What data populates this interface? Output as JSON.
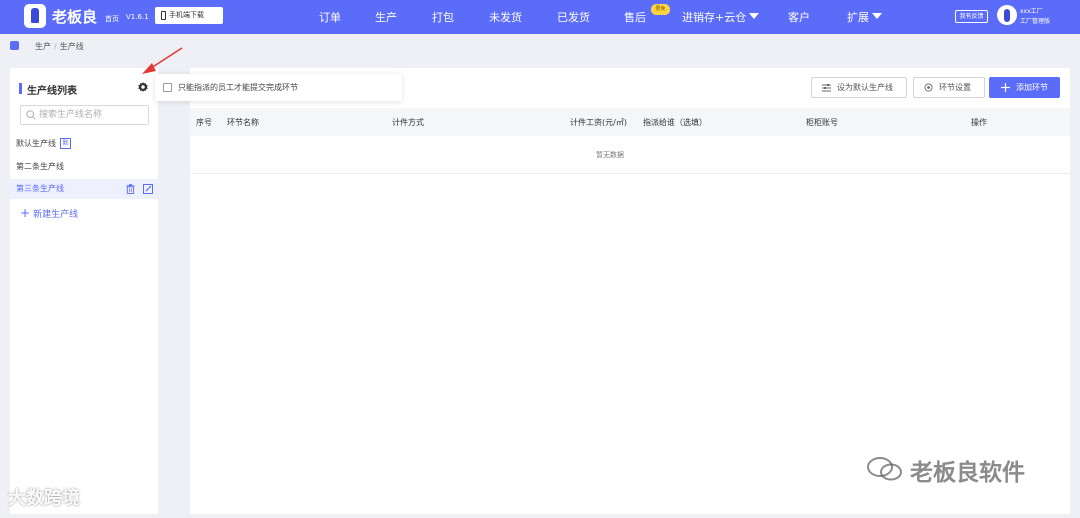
{
  "topbar": {
    "brand": "老板良",
    "home": "首页",
    "version": "V1.6.1",
    "download": "手机端下载",
    "nav": [
      "订单",
      "生产",
      "打包",
      "未发货",
      "已发货",
      "售后",
      "进销存+云仓",
      "客户",
      "扩展"
    ],
    "badge": "限免",
    "feedback": "我有反馈",
    "user_name": "xxx工厂",
    "user_role": "工厂管理版"
  },
  "breadcrumb": [
    "生产",
    "生产线"
  ],
  "left_panel": {
    "title": "生产线列表",
    "search_placeholder": "搜索生产线名称",
    "lines": [
      {
        "label": "默认生产线",
        "tag": "默"
      },
      {
        "label": "第二条生产线"
      },
      {
        "label": "第三条生产线"
      }
    ],
    "new_line": "新建生产线"
  },
  "popover": {
    "checkbox_label": "只能指派的员工才能提交完成环节",
    "checked": false
  },
  "toolbar": {
    "set_default": "设为默认生产线",
    "settings": "环节设置",
    "add": "添加环节"
  },
  "table": {
    "columns": [
      "序号",
      "环节名称",
      "计件方式",
      "计件工资(元/㎡)",
      "指派给谁（选填）",
      "柜柜账号",
      "操作"
    ],
    "empty_text": "暂无数据"
  },
  "watermarks": {
    "left": "大数跨境",
    "right": "老板良软件"
  },
  "colors": {
    "accent": "#5b6cf9",
    "annotation": "#e53935"
  }
}
